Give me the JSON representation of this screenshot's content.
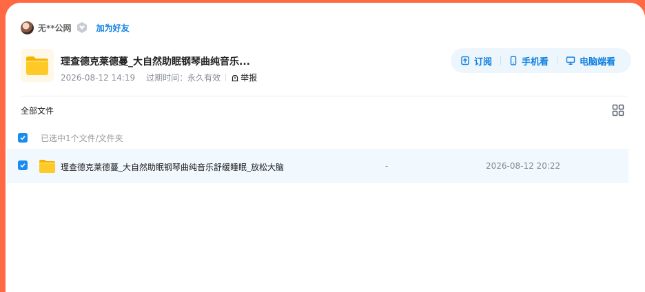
{
  "user": {
    "name": "无**公网",
    "add_friend": "加为好友"
  },
  "file": {
    "title": "理查德克莱德蔓_大自然助眠钢琴曲纯音乐...",
    "date": "2026-08-12 14:19",
    "expire_label": "过期时间：",
    "expire_value": "永久有效",
    "report": "举报"
  },
  "actions": {
    "subscribe": "订阅",
    "mobile": "手机看",
    "desktop": "电脑端看"
  },
  "list": {
    "all_files": "全部文件",
    "selected_text": "已选中1个文件/文件夹",
    "rows": [
      {
        "name": "理查德克莱德蔓_大自然助眠钢琴曲纯音乐舒缓睡眠_放松大脑",
        "size": "-",
        "date": "2026-08-12 20:22"
      }
    ]
  },
  "colors": {
    "accent": "#0d7fe0",
    "checkbox": "#1a8cf0",
    "background": "#ff6a45",
    "folder": "#ffc21a"
  }
}
